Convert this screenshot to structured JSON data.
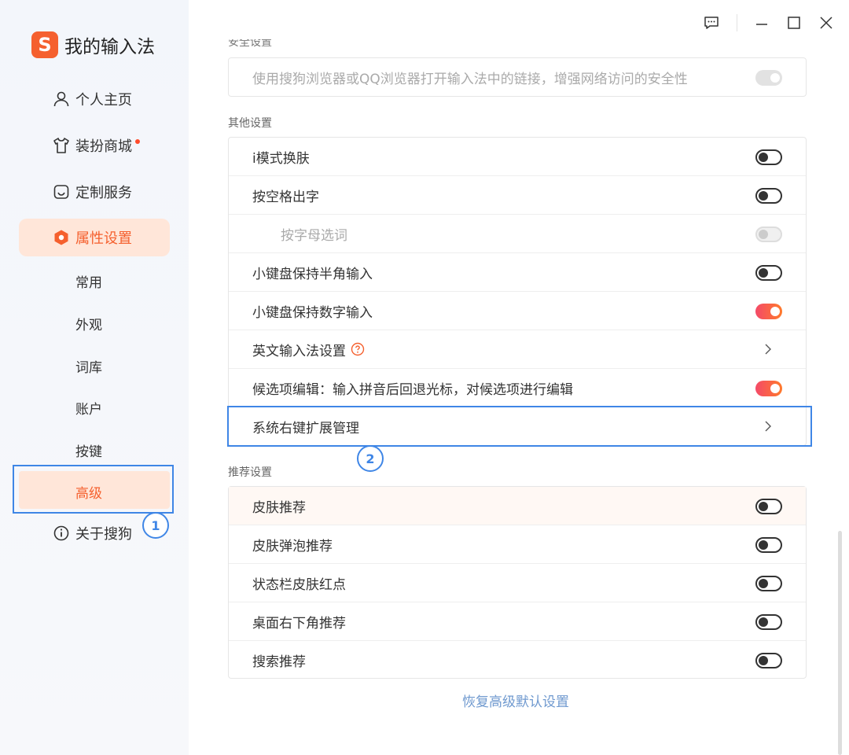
{
  "app": {
    "logo_letter": "S",
    "name": "我的输入法",
    "brand_color": "#f5602e"
  },
  "sidebar": {
    "items": [
      {
        "label": "个人主页",
        "icon": "user-icon"
      },
      {
        "label": "装扮商城",
        "icon": "tshirt-icon",
        "has_dot": true
      },
      {
        "label": "定制服务",
        "icon": "inbox-icon"
      },
      {
        "label": "属性设置",
        "icon": "hexagon-settings-icon",
        "active": true
      },
      {
        "label": "关于搜狗",
        "icon": "info-icon"
      }
    ],
    "sub_items": [
      "常用",
      "外观",
      "词库",
      "账户",
      "按键",
      "高级"
    ],
    "active_sub": "高级"
  },
  "callouts": {
    "one": "1",
    "two": "2"
  },
  "titlebar": {
    "icons": [
      "feedback-icon",
      "minimize-icon",
      "maximize-icon",
      "close-icon"
    ]
  },
  "content": {
    "top_section": {
      "partial_label": "安全设置",
      "row_label": "使用搜狗浏览器或QQ浏览器打开输入法中的链接，增强网络访问的安全性",
      "toggle": "disabled-on"
    },
    "other": {
      "label": "其他设置",
      "rows": [
        {
          "label": "i模式换肤",
          "control": "toggle",
          "state": "off"
        },
        {
          "label": "按空格出字",
          "control": "toggle",
          "state": "off"
        },
        {
          "label": "按字母选词",
          "control": "toggle",
          "state": "disabled"
        },
        {
          "label": "小键盘保持半角输入",
          "control": "toggle",
          "state": "off"
        },
        {
          "label": "小键盘保持数字输入",
          "control": "toggle",
          "state": "on"
        },
        {
          "label": "英文输入法设置",
          "control": "chevron",
          "help": true
        },
        {
          "label": "候选项编辑：输入拼音后回退光标，对候选项进行编辑",
          "control": "toggle",
          "state": "on"
        },
        {
          "label": "系统右键扩展管理",
          "control": "chevron"
        }
      ]
    },
    "recommend": {
      "label": "推荐设置",
      "rows": [
        {
          "label": "皮肤推荐",
          "state": "off"
        },
        {
          "label": "皮肤弹泡推荐",
          "state": "off"
        },
        {
          "label": "状态栏皮肤红点",
          "state": "off"
        },
        {
          "label": "桌面右下角推荐",
          "state": "off"
        },
        {
          "label": "搜索推荐",
          "state": "off"
        }
      ]
    },
    "restore_link": "恢复高级默认设置"
  },
  "colors": {
    "accent": "#f5602e",
    "active_bg": "#ffe6d9",
    "callout": "#3f86e6",
    "link": "#6f99cf"
  }
}
